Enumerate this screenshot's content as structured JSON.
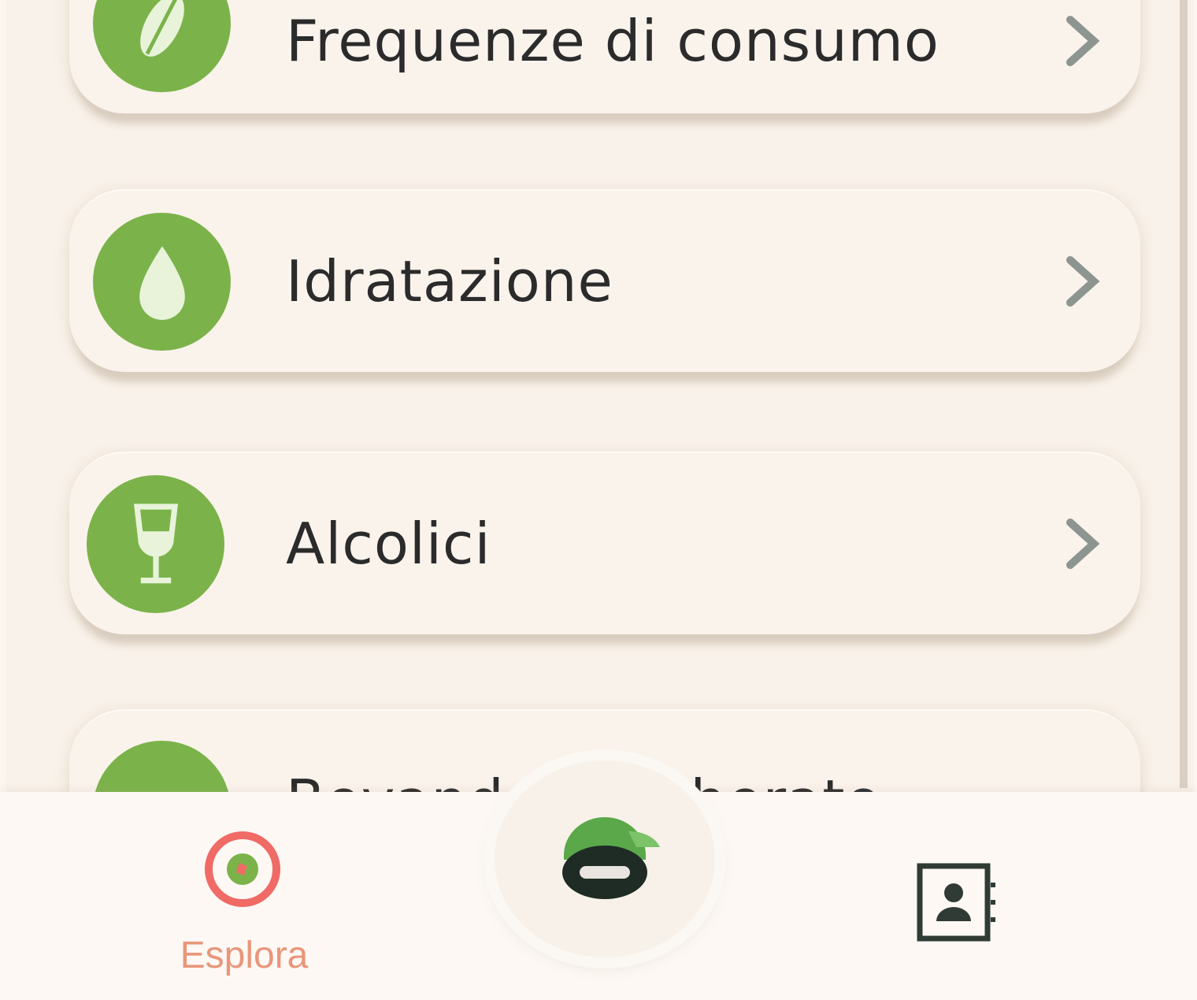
{
  "colors": {
    "accent_green": "#7bb34a",
    "explore_red": "#f06a66",
    "background": "#f9f2ea"
  },
  "list": {
    "items": [
      {
        "label": "Frequenze di consumo",
        "icon": "leaf-icon"
      },
      {
        "label": "Idratazione",
        "icon": "water-drop-icon"
      },
      {
        "label": "Alcolici",
        "icon": "wine-glass-icon"
      },
      {
        "label": "Bevande zuccherate",
        "icon": "drink-icon"
      }
    ]
  },
  "nav": {
    "explore_label": "Esplora",
    "explore_icon": "explore-icon",
    "center_icon": "mascot-icon",
    "profile_icon": "profile-book-icon"
  }
}
